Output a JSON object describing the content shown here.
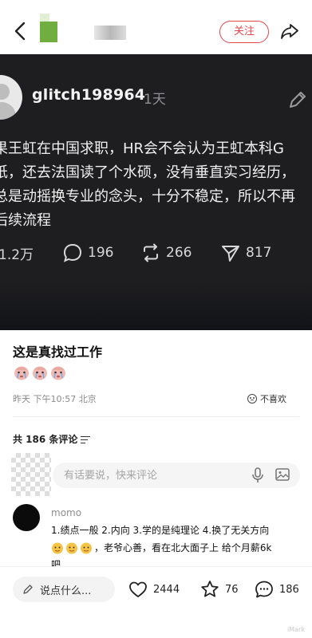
{
  "header": {
    "follow_label": "关注"
  },
  "screenshot": {
    "username": "glitch198964",
    "time": "1天",
    "text_lines": [
      "果王虹在中国求职，HR会不会认为王虹本科G",
      "纸，还去法国读了个水硕，没有垂直实习经历，",
      "总是动摇换专业的念头，十分不稳定，所以不再",
      "后续流程"
    ],
    "stats": {
      "likes": "1.2万",
      "comments": "196",
      "reposts": "266",
      "shares": "817"
    }
  },
  "post": {
    "title": "这是真找过工作",
    "meta": "昨天 下午10:57 北京",
    "dislike_label": "不喜欢"
  },
  "comments": {
    "count_label": "共 186 条评论",
    "input_placeholder": "有话要说，快来评论",
    "items": [
      {
        "name": "momo",
        "line1": "1.绩点一般 2.内向 3.学的是纯理论 4.换了无关方向",
        "line2": "，老爷心善，看在北大面子上 给个月薪6k",
        "line3": "吧"
      }
    ]
  },
  "bottom": {
    "say_label": "说点什么...",
    "likes": "2444",
    "stars": "76",
    "comments": "186"
  },
  "watermark": "iMark",
  "colors": {
    "accent": "#e2474f",
    "dark_bg": "#1e1e20"
  }
}
